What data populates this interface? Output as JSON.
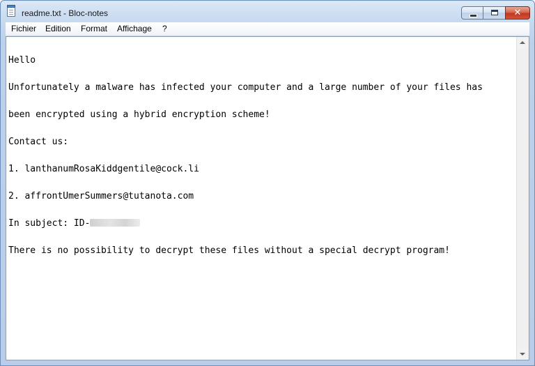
{
  "window": {
    "title": "readme.txt - Bloc-notes",
    "icon": "notepad-icon",
    "caption_buttons": {
      "minimize": "minimize-icon",
      "maximize": "maximize-icon",
      "close": "✕"
    }
  },
  "menu": {
    "items": [
      {
        "label": "Fichier"
      },
      {
        "label": "Edition"
      },
      {
        "label": "Format"
      },
      {
        "label": "Affichage"
      },
      {
        "label": "?"
      }
    ]
  },
  "document": {
    "lines": [
      "Hello",
      "Unfortunately a malware has infected your computer and a large number of your files has",
      "been encrypted using a hybrid encryption scheme!",
      "Contact us:",
      "1. lanthanumRosaKiddgentile@cock.li",
      "2. affrontUmerSummers@tutanota.com",
      "In subject: ID-",
      "There is no possibility to decrypt these files without a special decrypt program!"
    ]
  },
  "colors": {
    "frame": "#b9cde8",
    "close_button": "#c2371e",
    "text": "#000000"
  }
}
